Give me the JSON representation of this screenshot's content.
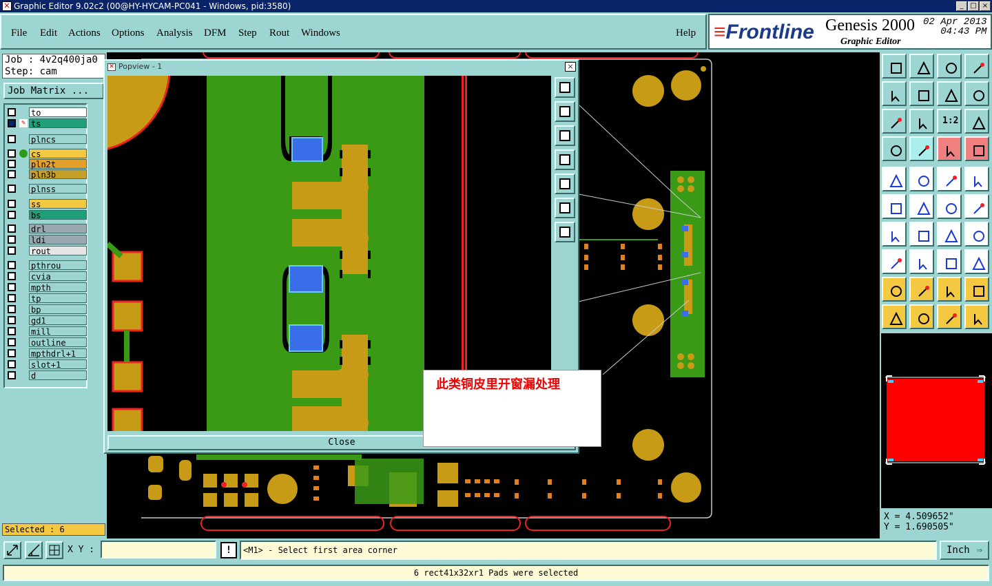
{
  "window": {
    "title": "Graphic Editor 9.02c2 (00@HY-HYCAM-PC041 - Windows, pid:3580)",
    "min": "_",
    "max": "□",
    "close": "×"
  },
  "menu": [
    "File",
    "Edit",
    "Actions",
    "Options",
    "Analysis",
    "DFM",
    "Step",
    "Rout",
    "Windows"
  ],
  "help": "Help",
  "logo": {
    "brand": "Frontline",
    "product": "Genesis 2000",
    "subtitle": "Graphic Editor",
    "date": "02 Apr 2013",
    "time": "04:43 PM"
  },
  "job": {
    "job_label": "Job : 4v2q400ja0",
    "step_label": "Step: cam",
    "matrix": "Job Matrix ..."
  },
  "layers": [
    {
      "name": "to",
      "color": "#ffffff"
    },
    {
      "name": "ts",
      "color": "#1f9e78"
    },
    {
      "name": "plncs",
      "color": "#9cd5d2"
    },
    {
      "name": "cs",
      "color": "#f5c842"
    },
    {
      "name": "pln2t",
      "color": "#e3a12b"
    },
    {
      "name": "pln3b",
      "color": "#c5a02a"
    },
    {
      "name": "plnss",
      "color": "#9cd5d2"
    },
    {
      "name": "ss",
      "color": "#f5c842"
    },
    {
      "name": "bs",
      "color": "#1f9e78"
    },
    {
      "name": "drl",
      "color": "#9aa8b0"
    },
    {
      "name": "ldi",
      "color": "#9aa8b0"
    },
    {
      "name": "rout",
      "color": "#e6e6e6"
    },
    {
      "name": "pthrou",
      "color": "#9cd5d2"
    },
    {
      "name": "cvia",
      "color": "#9cd5d2"
    },
    {
      "name": "mpth",
      "color": "#9cd5d2"
    },
    {
      "name": "tp",
      "color": "#9cd5d2"
    },
    {
      "name": "bp",
      "color": "#9cd5d2"
    },
    {
      "name": "gd1",
      "color": "#9cd5d2"
    },
    {
      "name": "mill",
      "color": "#9cd5d2"
    },
    {
      "name": "outline",
      "color": "#9cd5d2"
    },
    {
      "name": "mpthdrl+1",
      "color": "#9cd5d2"
    },
    {
      "name": "slot+1",
      "color": "#9cd5d2"
    },
    {
      "name": "d",
      "color": "#9cd5d2"
    }
  ],
  "selected": "Selected : 6",
  "popview": {
    "title": "Popview - 1",
    "close_label": "Close"
  },
  "annotation": "此类铜皮里开窗漏处理",
  "toolbar_icons": [
    "home-up-icon",
    "home-down-icon",
    "house-icon",
    "split-icon",
    "zoom-left-icon",
    "zoom-right-icon",
    "flip-icon",
    "s-curve-icon",
    "fit-icon",
    "center-icon",
    "ratio-icon",
    "help-icon",
    "wrench-icon",
    "grid-icon",
    "snap-icon",
    "snap-active-icon",
    "pan-icon",
    "measure-icon",
    "ruler-icon",
    "dot-icon",
    "connect-icon",
    "cross-icon",
    "line-icon",
    "arrow-icon",
    "angle-icon",
    "pen-icon",
    "arc-icon",
    "text-icon",
    "target-icon",
    "minus-icon",
    "fit-box-icon",
    "layers-icon",
    "triangle-a-icon",
    "triangle-b-icon",
    "triangle-c-icon",
    "triangle-d-icon",
    "pointer-icon",
    "pointer-box-icon",
    "pointer-alt-icon",
    "route-icon"
  ],
  "ratio_label": "1:2",
  "coords": {
    "x": "X = 4.509652\"",
    "y": "Y = 1.690505\""
  },
  "bottom": {
    "xy_label": "X Y :",
    "xy_value": "",
    "prompt": "<M1> - Select first area corner",
    "unit": "Inch",
    "excl": "!"
  },
  "status": "6 rect41x32xr1 Pads were selected"
}
